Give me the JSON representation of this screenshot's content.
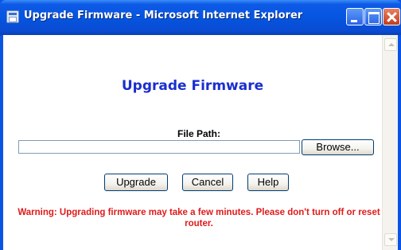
{
  "window": {
    "title": "Upgrade Firmware - Microsoft Internet Explorer",
    "icons": {
      "app": "ie-page-icon",
      "minimize": "minimize-icon",
      "maximize": "maximize-icon",
      "close": "close-icon"
    }
  },
  "page": {
    "title": "Upgrade Firmware",
    "file_path_label": "File Path:",
    "file_path_value": "",
    "browse_label": "Browse...",
    "buttons": {
      "upgrade": "Upgrade",
      "cancel": "Cancel",
      "help": "Help"
    },
    "warning": "Warning: Upgrading firmware may take a few minutes. Please don't turn off or reset router."
  },
  "colors": {
    "title_blue": "#1a2fcf",
    "warning_red": "#e01a1a",
    "titlebar_blue": "#0555e0"
  }
}
